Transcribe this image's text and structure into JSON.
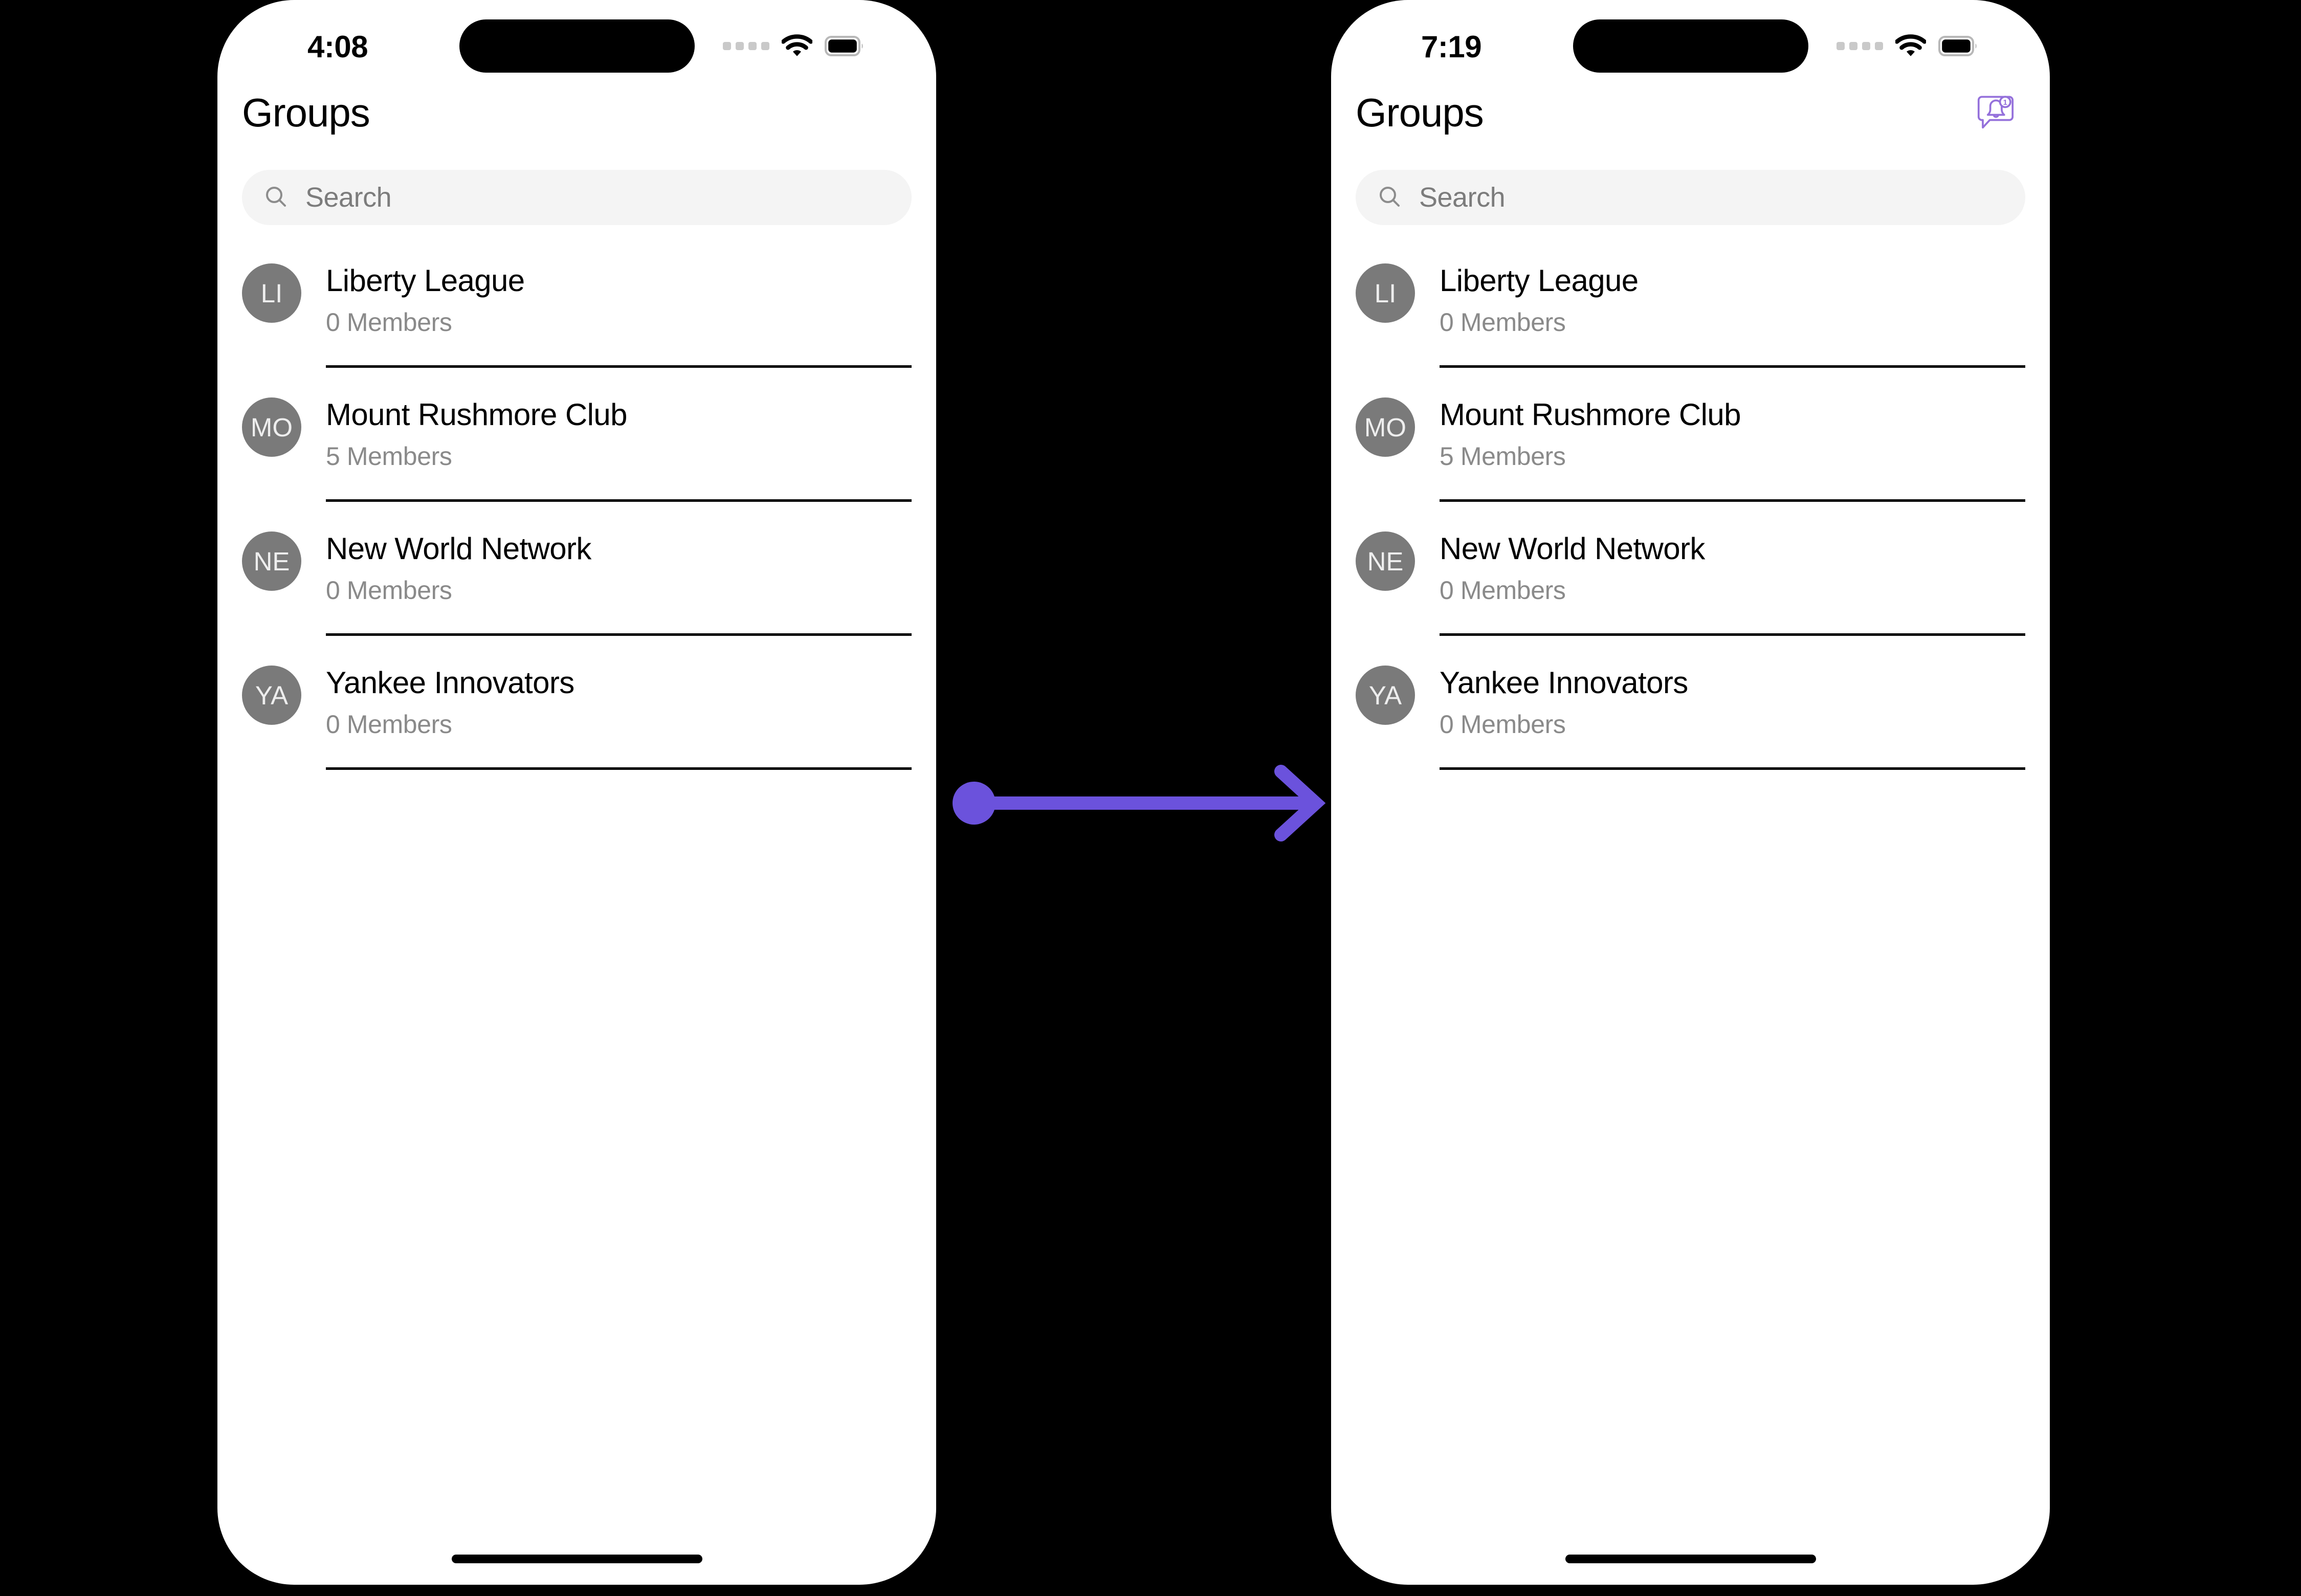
{
  "colors": {
    "accent": "#6B52DC",
    "avatar_bg": "#7A7A7A",
    "search_bg": "#F4F4F4",
    "subtitle": "#8A8A8A",
    "divider": "#000000",
    "phone_bg": "#FFFFFF",
    "canvas_bg": "#000000"
  },
  "annotation": {
    "type": "arrow",
    "direction": "left-to-right",
    "color": "#6B52DC",
    "start_marker": "dot",
    "end_marker": "chevron-arrowhead"
  },
  "screens": [
    {
      "id": "before",
      "status_bar": {
        "time": "4:08",
        "cellular_icon": "signal-dots-icon",
        "wifi_icon": "wifi-icon",
        "battery_icon": "battery-full-icon"
      },
      "header": {
        "title": "Groups",
        "has_notification_button": false,
        "notification_icon": "",
        "notification_badge": ""
      },
      "search": {
        "icon": "search-icon",
        "placeholder": "Search",
        "value": ""
      },
      "groups": [
        {
          "initials": "LI",
          "name": "Liberty League",
          "members": "0 Members"
        },
        {
          "initials": "MO",
          "name": "Mount Rushmore Club",
          "members": "5 Members"
        },
        {
          "initials": "NE",
          "name": "New World Network",
          "members": "0 Members"
        },
        {
          "initials": "YA",
          "name": "Yankee Innovators",
          "members": "0 Members"
        }
      ],
      "home_indicator": true
    },
    {
      "id": "after",
      "status_bar": {
        "time": "7:19",
        "cellular_icon": "signal-dots-icon",
        "wifi_icon": "wifi-icon",
        "battery_icon": "battery-full-icon"
      },
      "header": {
        "title": "Groups",
        "has_notification_button": true,
        "notification_icon": "notification-bell-bubble-icon",
        "notification_badge": "1"
      },
      "search": {
        "icon": "search-icon",
        "placeholder": "Search",
        "value": ""
      },
      "groups": [
        {
          "initials": "LI",
          "name": "Liberty League",
          "members": "0 Members"
        },
        {
          "initials": "MO",
          "name": "Mount Rushmore Club",
          "members": "5 Members"
        },
        {
          "initials": "NE",
          "name": "New World Network",
          "members": "0 Members"
        },
        {
          "initials": "YA",
          "name": "Yankee Innovators",
          "members": "0 Members"
        }
      ],
      "home_indicator": true
    }
  ]
}
